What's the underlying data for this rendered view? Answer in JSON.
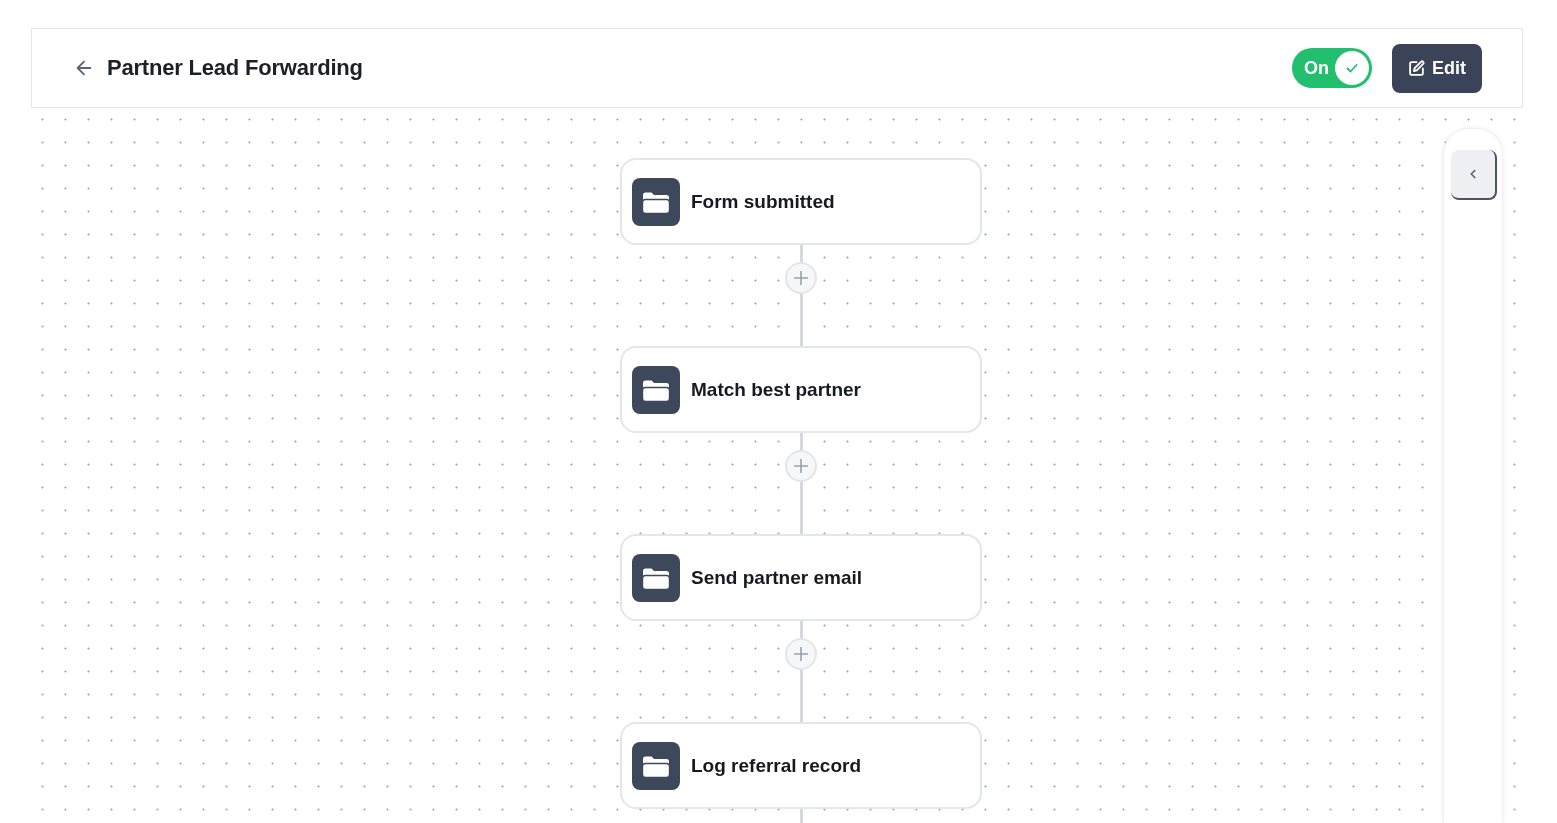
{
  "header": {
    "title": "Partner Lead Forwarding",
    "toggle": {
      "label": "On",
      "on": true
    },
    "edit_button": {
      "label": "Edit"
    }
  },
  "steps": [
    {
      "label": "Form submitted"
    },
    {
      "label": "Match best partner"
    },
    {
      "label": "Send partner email"
    },
    {
      "label": "Log referral record"
    }
  ]
}
